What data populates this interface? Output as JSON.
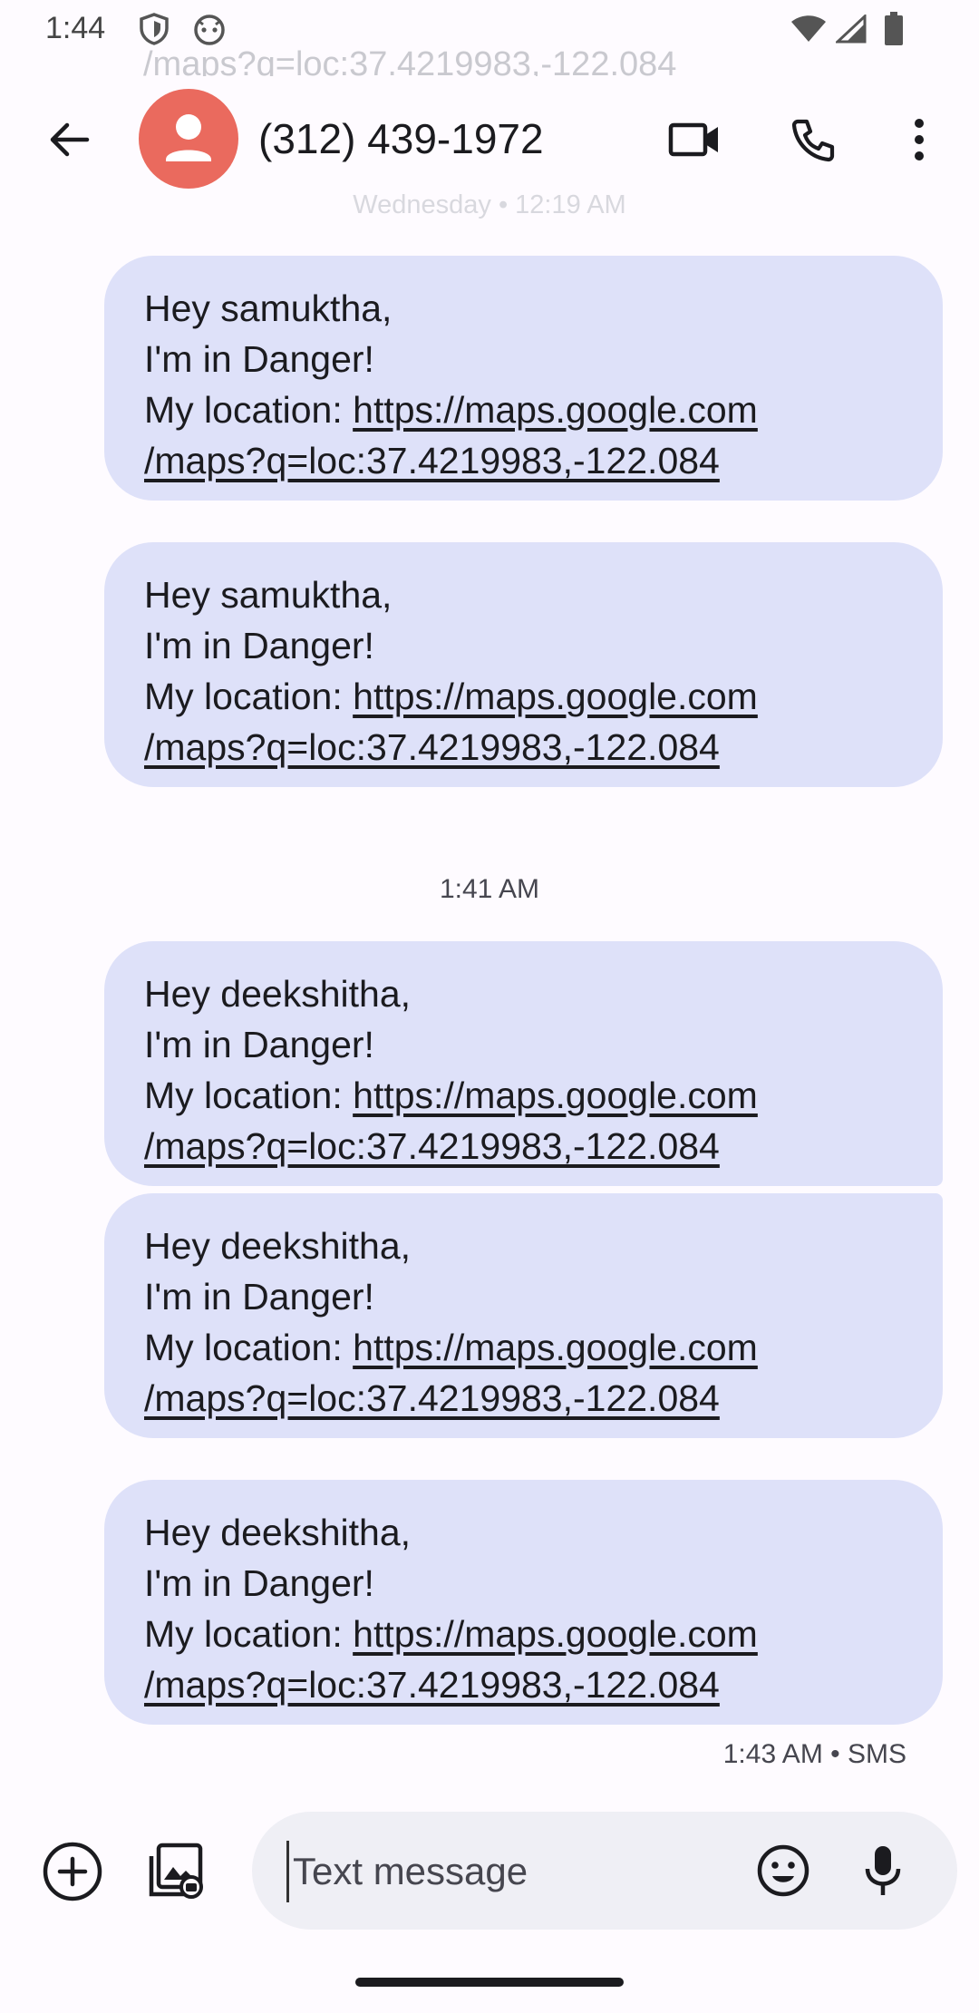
{
  "status_bar": {
    "time": "1:44"
  },
  "background_text": {
    "link_fragment": "/maps?q=loc:37.4219983,-122.084",
    "date_label": "Wednesday • 12:19 AM"
  },
  "header": {
    "contact": "(312) 439-1972",
    "icons": [
      "back-arrow-icon",
      "avatar-person-icon",
      "video-call-icon",
      "phone-icon",
      "more-vert-icon"
    ]
  },
  "messages": [
    {
      "greeting": "Hey samuktha,",
      "alert": "I'm in Danger!",
      "location_label": "My location: ",
      "link_line1": "https://maps.google.com",
      "link_line2": "/maps?q=loc:37.4219983,-122.084"
    },
    {
      "greeting": "Hey samuktha,",
      "alert": "I'm in Danger!",
      "location_label": "My location: ",
      "link_line1": "https://maps.google.com",
      "link_line2": "/maps?q=loc:37.4219983,-122.084"
    },
    {
      "greeting": "Hey deekshitha,",
      "alert": "I'm in Danger!",
      "location_label": "My location: ",
      "link_line1": "https://maps.google.com",
      "link_line2": "/maps?q=loc:37.4219983,-122.084"
    },
    {
      "greeting": "Hey deekshitha,",
      "alert": "I'm in Danger!",
      "location_label": "My location: ",
      "link_line1": "https://maps.google.com",
      "link_line2": "/maps?q=loc:37.4219983,-122.084"
    },
    {
      "greeting": "Hey deekshitha,",
      "alert": "I'm in Danger!",
      "location_label": "My location: ",
      "link_line1": "https://maps.google.com",
      "link_line2": "/maps?q=loc:37.4219983,-122.084"
    }
  ],
  "timestamps": {
    "divider": "1:41 AM",
    "last_meta": "1:43 AM • SMS"
  },
  "compose": {
    "placeholder": "Text message",
    "value": ""
  },
  "colors": {
    "bubble": "#dee1f9",
    "avatar": "#ea6a5e",
    "compose_bg": "#efeff5",
    "background": "#fefbff"
  }
}
